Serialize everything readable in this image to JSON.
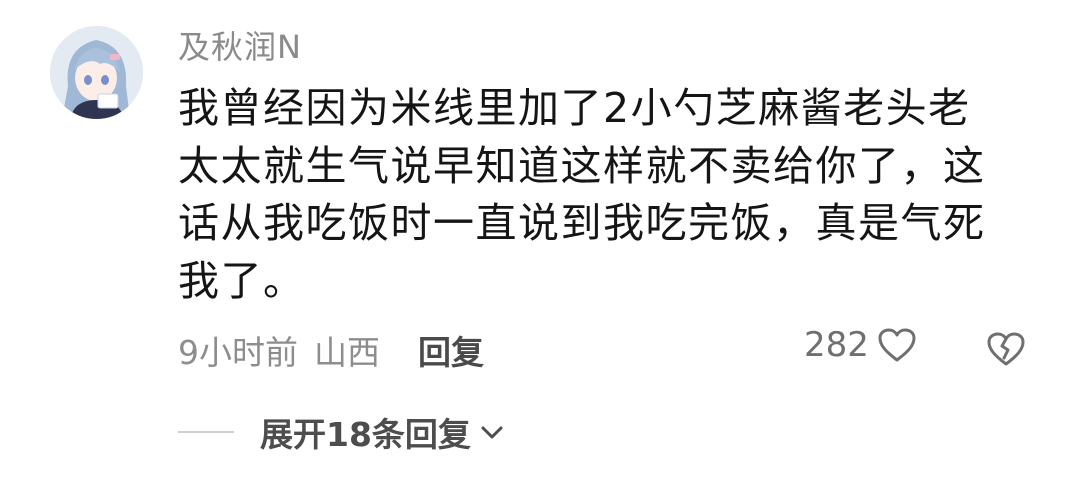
{
  "comment": {
    "username": "及秋润N",
    "text_lines": [
      "我曾经因为米线里加了2小勺芝麻酱老头老",
      "太太就生气说早知道这样就不卖给你了，这",
      "话从我吃饭时一直说到我吃完饭，真是气死",
      "我了。"
    ],
    "time": "9小时前",
    "location": "山西",
    "reply_label": "回复",
    "like_count": "282",
    "expand_replies_label": "展开18条回复"
  },
  "icons": {
    "like": "heart-outline-icon",
    "dislike": "broken-heart-icon",
    "expand": "chevron-down-icon"
  },
  "colors": {
    "username": "#8a8a8a",
    "body_text": "#151515",
    "meta_text": "#8d8d8d",
    "action_text": "#4a4a4a"
  }
}
